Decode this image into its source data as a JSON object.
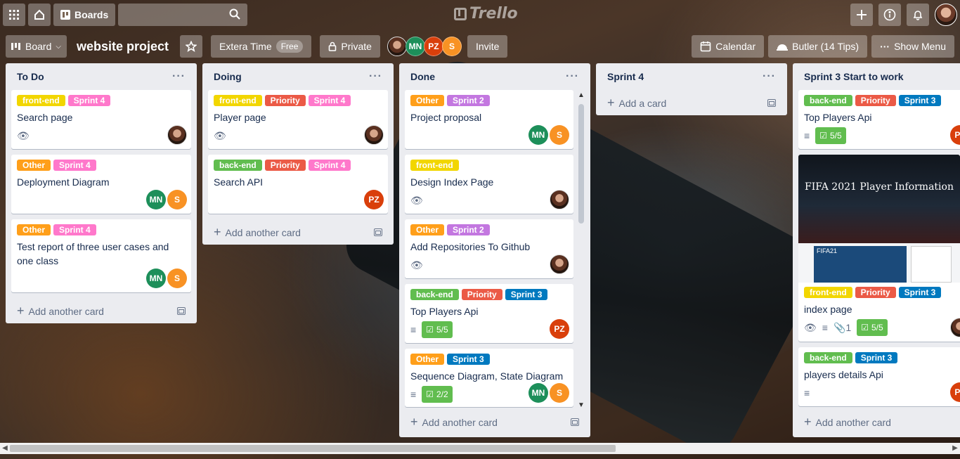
{
  "header": {
    "boards_label": "Boards",
    "search_placeholder": "",
    "logo_text": "Trello"
  },
  "board": {
    "view_label": "Board",
    "title": "website project",
    "team_name": "Extera Time",
    "team_badge": "Free",
    "visibility_label": "Private",
    "invite_label": "Invite",
    "calendar_label": "Calendar",
    "butler_label": "Butler (14 Tips)",
    "menu_label": "Show Menu",
    "members": [
      "MN",
      "PZ",
      "S"
    ]
  },
  "colors": {
    "front-end": "#f2d600",
    "sprint4": "#ff78cb",
    "other": "#ff9f1a",
    "back-end": "#61bd4f",
    "priority": "#eb5a46",
    "sprint2": "#c377e0",
    "sprint3": "#0079bf"
  },
  "add_card_label": "Add another card",
  "add_a_card_label": "Add a card",
  "lists": [
    {
      "title": "To Do",
      "cards": [
        {
          "labels": [
            "front-end",
            "Sprint 4"
          ],
          "title": "Search page",
          "watched": true
        },
        {
          "labels": [
            "Other",
            "Sprint 4"
          ],
          "title": "Deployment Diagram",
          "members": [
            "MN",
            "S"
          ]
        },
        {
          "labels": [
            "Other",
            "Sprint 4"
          ],
          "title": "Test report of three user cases and one class",
          "members": [
            "MN",
            "S"
          ]
        }
      ]
    },
    {
      "title": "Doing",
      "cards": [
        {
          "labels": [
            "front-end",
            "Priority",
            "Sprint 4"
          ],
          "title": "Player page",
          "watched": true
        },
        {
          "labels": [
            "back-end",
            "Priority",
            "Sprint 4"
          ],
          "title": "Search API",
          "members": [
            "PZ"
          ]
        }
      ]
    },
    {
      "title": "Done",
      "cards": [
        {
          "labels": [
            "Other",
            "Sprint 2"
          ],
          "title": "Project proposal",
          "members": [
            "MN",
            "S"
          ]
        },
        {
          "labels": [
            "front-end"
          ],
          "title": "Design Index Page",
          "watched": true
        },
        {
          "labels": [
            "Other",
            "Sprint 2"
          ],
          "title": "Add Repositories To Github",
          "watched": true
        },
        {
          "labels": [
            "back-end",
            "Priority",
            "Sprint 3"
          ],
          "title": "Top Players Api",
          "checklist": "5/5",
          "members": [
            "PZ"
          ]
        },
        {
          "labels": [
            "Other",
            "Sprint 3"
          ],
          "title": "Sequence Diagram, State Diagram",
          "checklist": "2/2",
          "members": [
            "MN",
            "S"
          ]
        }
      ]
    },
    {
      "title": "Sprint 4",
      "cards": []
    },
    {
      "title": "Sprint 3 Start to work",
      "cards": [
        {
          "labels": [
            "back-end",
            "Priority",
            "Sprint 3"
          ],
          "title": "Top Players Api",
          "checklist": "5/5",
          "members": [
            "PZ"
          ]
        },
        {
          "labels": [
            "front-end",
            "Priority",
            "Sprint 3"
          ],
          "title": "index page",
          "cover_text": "FIFA 2021 Player Information",
          "cover_sub": "FIFA21",
          "attachments": "1",
          "checklist": "5/5"
        },
        {
          "labels": [
            "back-end",
            "Sprint 3"
          ],
          "title": "players details Api",
          "members": [
            "PZ"
          ]
        }
      ]
    }
  ]
}
